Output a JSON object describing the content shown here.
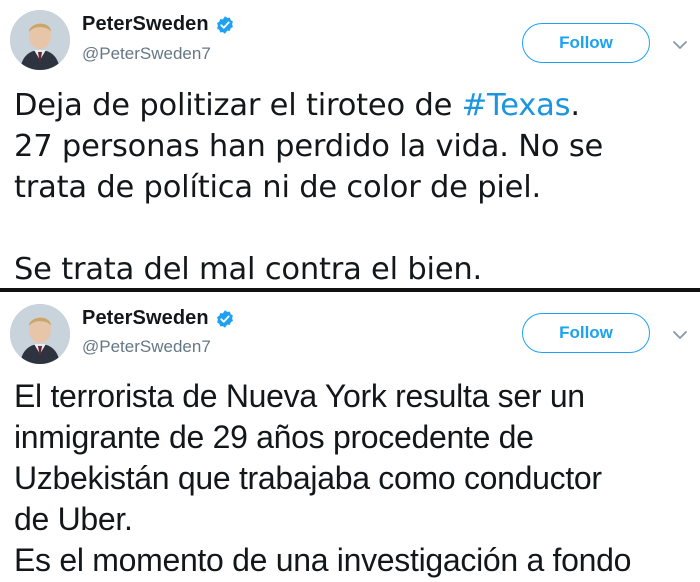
{
  "tweets": [
    {
      "display_name": "PeterSweden",
      "handle": "@PeterSweden7",
      "follow_label": "Follow",
      "text_before_hashtag": "Deja de politizar el tiroteo de ",
      "hashtag": "#Texas",
      "text_after_hashtag": ".\n27 personas han perdido la vida. No se\ntrata de política ni de color de piel.\n\nSe trata del mal contra el bien."
    },
    {
      "display_name": "PeterSweden",
      "handle": "@PeterSweden7",
      "follow_label": "Follow",
      "lines": [
        "El terrorista de Nueva York resulta ser un",
        "inmigrante de 29 años procedente de",
        "Uzbekistán que trabajaba como conductor",
        "de Uber.",
        "Es el momento de una investigación a fondo"
      ]
    }
  ],
  "colors": {
    "accent": "#1da1f2",
    "hashtag": "#1b95e0",
    "handle": "#657786",
    "text": "#14171a",
    "divider": "#111111"
  },
  "icons": {
    "verified": "verified-badge-icon",
    "chevron": "chevron-down-icon"
  }
}
